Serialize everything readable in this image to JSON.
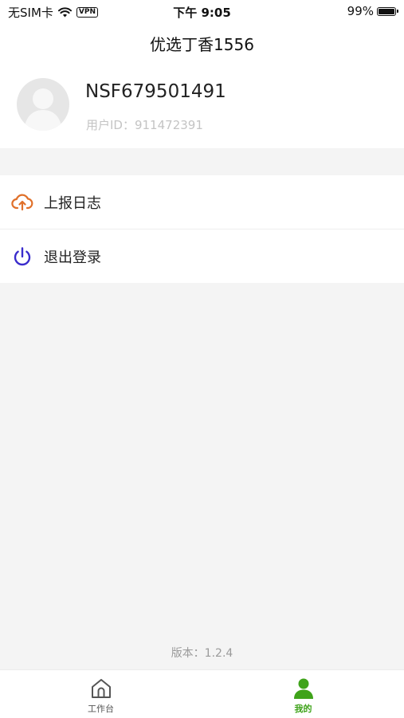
{
  "status_bar": {
    "carrier": "无SIM卡",
    "vpn": "VPN",
    "time": "下午 9:05",
    "battery": "99%"
  },
  "header": {
    "title": "优选丁香1556"
  },
  "profile": {
    "username": "NSF679501491",
    "user_id": "用户ID：911472391"
  },
  "menu": {
    "items": [
      {
        "label": "上报日志",
        "icon": "cloud-upload-icon",
        "color": "#e0702a"
      },
      {
        "label": "退出登录",
        "icon": "power-icon",
        "color": "#3a2ccc"
      }
    ]
  },
  "footer": {
    "version": "版本：1.2.4"
  },
  "tabbar": {
    "items": [
      {
        "label": "工作台",
        "icon": "home-icon",
        "active": false
      },
      {
        "label": "我的",
        "icon": "user-icon",
        "active": true
      }
    ],
    "active_color": "#3fa31a",
    "inactive_color": "#555555"
  }
}
